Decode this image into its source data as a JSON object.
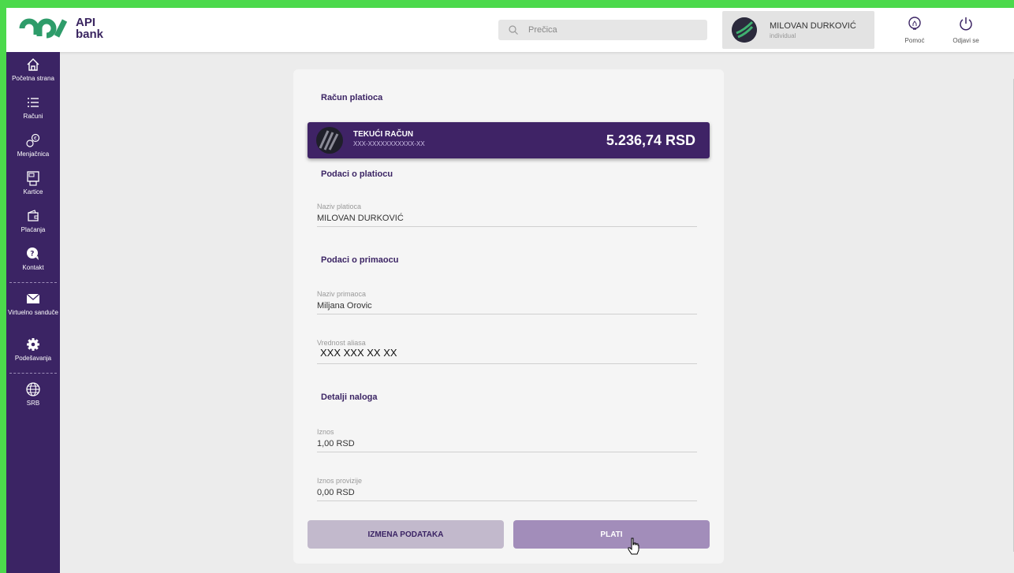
{
  "header": {
    "logo_text_1": "API",
    "logo_text_2": "bank",
    "search_placeholder": "Prečica",
    "user_name": "MILOVAN DURKOVIĆ",
    "user_role": "individual",
    "help_label": "Pomoć",
    "logout_label": "Odjavi se"
  },
  "sidebar": {
    "items": [
      {
        "label": "Početna strana",
        "icon": "home-icon"
      },
      {
        "label": "Računi",
        "icon": "list-icon"
      },
      {
        "label": "Menjačnica",
        "icon": "exchange-icon"
      },
      {
        "label": "Kartice",
        "icon": "card-icon"
      },
      {
        "label": "Plaćanja",
        "icon": "wallet-icon"
      },
      {
        "label": "Kontakt",
        "icon": "chat-icon"
      },
      {
        "label": "Virtuelno sanduče",
        "icon": "mail-icon"
      },
      {
        "label": "Podešavanja",
        "icon": "gear-icon"
      },
      {
        "label": "SRB",
        "icon": "globe-icon"
      }
    ]
  },
  "form": {
    "payer_account_title": "Račun platioca",
    "account": {
      "name": "TEKUĆI RAČUN",
      "number": "XXX-XXXXXXXXXXX-XX",
      "balance": "5.236,74 RSD"
    },
    "payer_section": "Podaci o platiocu",
    "payer_name_label": "Naziv platioca",
    "payer_name_value": "MILOVAN DURKOVIĆ",
    "recipient_section": "Podaci o primaocu",
    "recipient_name_label": "Naziv primaoca",
    "recipient_name_value": "Miljana Orovic",
    "alias_label": "Vrednost aliasa",
    "alias_value": "XXX XXX XX XX",
    "order_section": "Detalji naloga",
    "amount_label": "Iznos",
    "amount_value": "1,00 RSD",
    "fee_label": "Iznos provizije",
    "fee_value": "0,00 RSD",
    "edit_button": "IZMENA PODATAKA",
    "pay_button": "PLATI"
  },
  "colors": {
    "brand_purple": "#3b2464",
    "frame_green": "#4cd94c",
    "pay_button": "#a28dba",
    "edit_button": "#c2b9cc"
  }
}
